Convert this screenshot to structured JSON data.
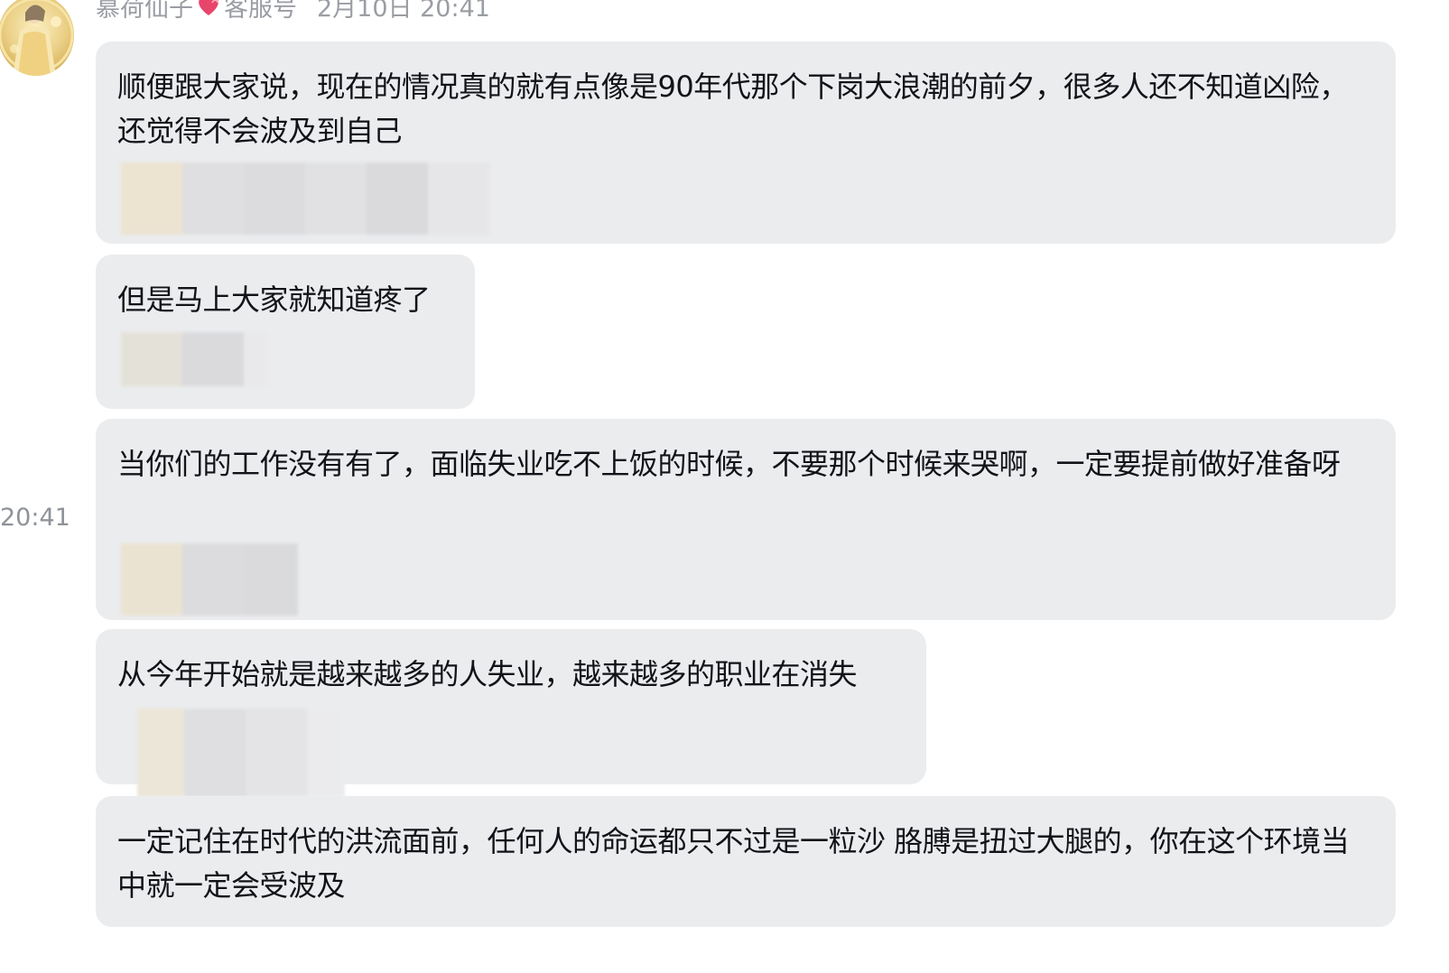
{
  "sender": {
    "name": "慕荷仙子",
    "badge_icon": "heart-icon",
    "role": "客服号",
    "timestamp": "2月10日 20:41"
  },
  "side_timestamp": "20:41",
  "messages": [
    {
      "text": "顺便跟大家说，现在的情况真的就有点像是90年代那个下岗大浪潮的前夕，很多人还不知道凶险，还觉得不会波及到自己"
    },
    {
      "text": "但是马上大家就知道疼了"
    },
    {
      "text": "当你们的工作没有有了，面临失业吃不上饭的时候，不要那个时候来哭啊，一定要提前做好准备呀"
    },
    {
      "text": "从今年开始就是越来越多的人失业，越来越多的职业在消失"
    },
    {
      "text": "一定记住在时代的洪流面前，任何人的命运都只不过是一粒沙  胳膊是扭过大腿的，你在这个环境当中就一定会受波及"
    }
  ],
  "colors": {
    "bubble_bg": "#ebecee",
    "text": "#111318",
    "meta_text": "#9a9da3",
    "heart": "#e8456b"
  }
}
